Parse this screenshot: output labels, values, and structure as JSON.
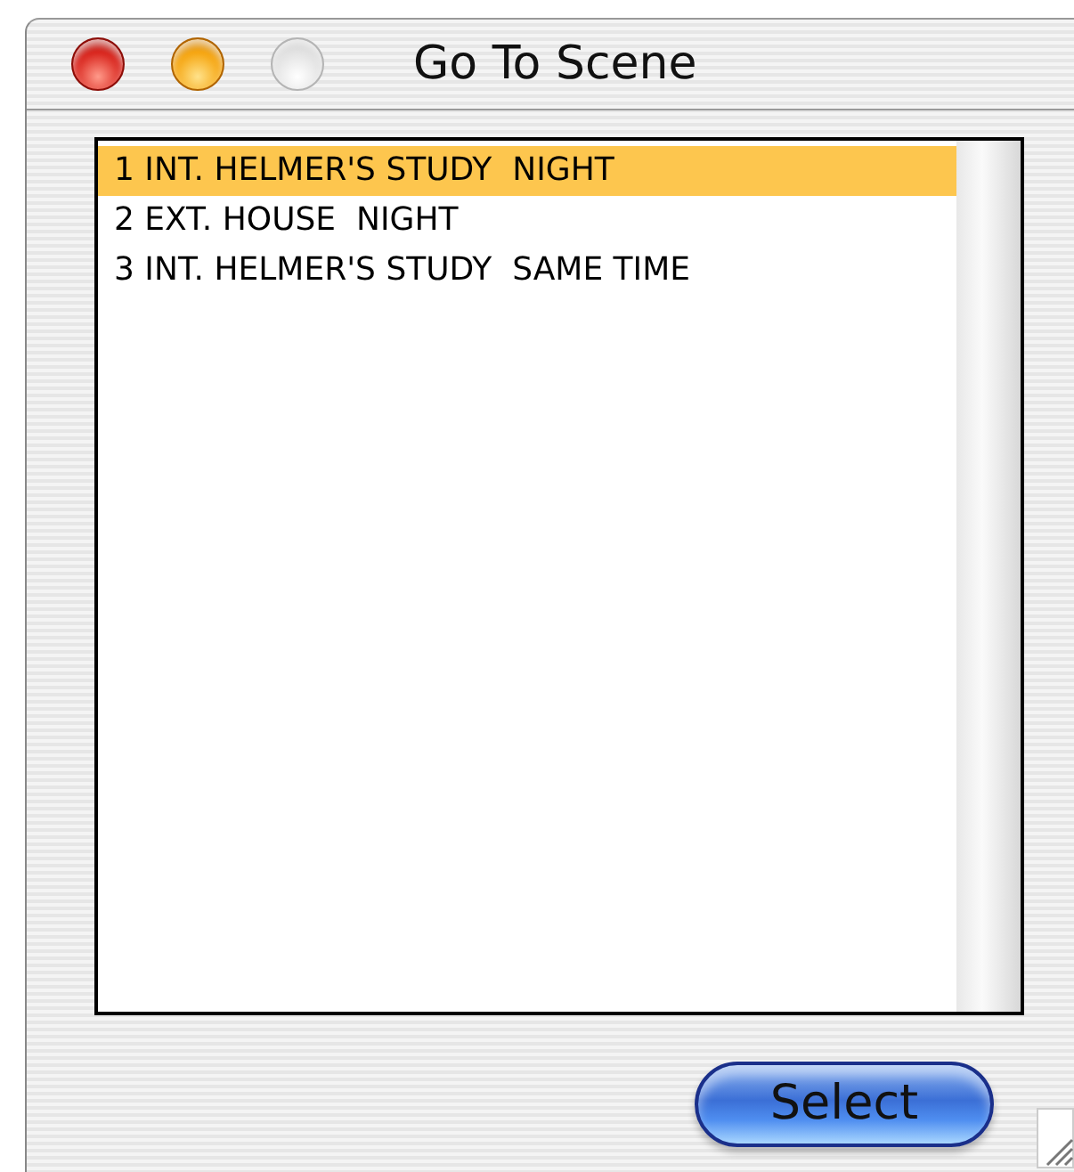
{
  "window": {
    "title": "Go To Scene",
    "controls": [
      {
        "kind": "close",
        "disabled": false
      },
      {
        "kind": "minimize",
        "disabled": false
      },
      {
        "kind": "zoom",
        "disabled": true
      }
    ]
  },
  "scenes": [
    {
      "label": "1 INT. HELMER'S STUDY  NIGHT",
      "selected": true
    },
    {
      "label": "2 EXT. HOUSE  NIGHT",
      "selected": false
    },
    {
      "label": "3 INT. HELMER'S STUDY  SAME TIME",
      "selected": false
    }
  ],
  "button": {
    "label": "Select"
  }
}
